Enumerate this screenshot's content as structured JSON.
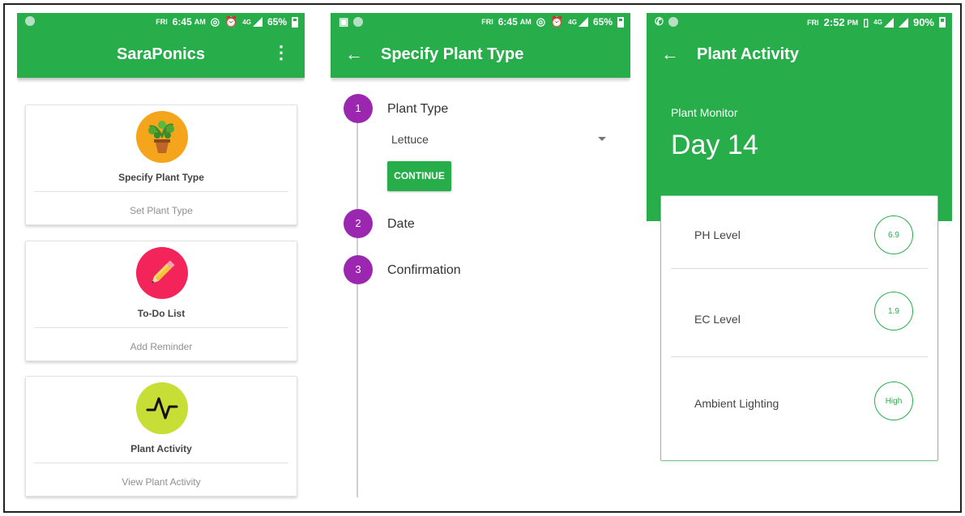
{
  "colors": {
    "accent": "#27ae4b",
    "step": "#9b27b0"
  },
  "screen1": {
    "status": {
      "day": "FRI",
      "time": "6:45",
      "ampm": "AM",
      "battery": "65%",
      "net": "4G"
    },
    "app_title": "SaraPonics",
    "menu_icon": "more-vert-icon",
    "cards": [
      {
        "title": "Specify Plant Type",
        "action": "Set Plant Type",
        "icon": "potted-plant-icon",
        "color": "#f4a51c"
      },
      {
        "title": "To-Do List",
        "action": "Add Reminder",
        "icon": "pencil-icon",
        "color": "#f3245a"
      },
      {
        "title": "Plant Activity",
        "action": "View Plant Activity",
        "icon": "activity-pulse-icon",
        "color": "#c6de36"
      }
    ]
  },
  "screen2": {
    "status": {
      "day": "FRI",
      "time": "6:45",
      "ampm": "AM",
      "battery": "65%",
      "net": "4G"
    },
    "title": "Specify Plant Type",
    "steps": [
      {
        "num": "1",
        "label": "Plant Type"
      },
      {
        "num": "2",
        "label": "Date"
      },
      {
        "num": "3",
        "label": "Confirmation"
      }
    ],
    "select_value": "Lettuce",
    "continue_label": "CONTINUE"
  },
  "screen3": {
    "status": {
      "day": "FRI",
      "time": "2:52",
      "ampm": "PM",
      "battery": "90%",
      "net": "4G"
    },
    "title": "Plant Activity",
    "monitor_label": "Plant Monitor",
    "day_label": "Day 14",
    "metrics": [
      {
        "label": "PH Level",
        "value": "6.9"
      },
      {
        "label": "EC Level",
        "value": "1.9"
      },
      {
        "label": "Ambient Lighting",
        "value": "High"
      }
    ]
  }
}
